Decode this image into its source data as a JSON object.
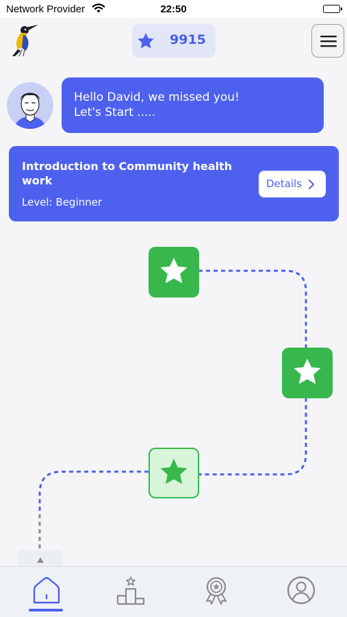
{
  "status_bar": {
    "carrier": "Network Provider",
    "time": "22:50"
  },
  "header": {
    "points": "9915",
    "icons": {
      "logo": "bird-logo",
      "points": "star-icon",
      "menu": "hamburger-menu-icon"
    }
  },
  "greeting": {
    "line1": "Hello David, we missed you!",
    "line2": "Let's Start ....."
  },
  "course": {
    "title": "Introduction to Community health work",
    "level": "Level: Beginner",
    "details_label": "Details"
  },
  "levels": [
    {
      "status": "completed"
    },
    {
      "status": "completed"
    },
    {
      "status": "current"
    }
  ],
  "tabs": [
    {
      "name": "home",
      "icon": "home-icon",
      "active": true
    },
    {
      "name": "leaderboard",
      "icon": "podium-icon",
      "active": false
    },
    {
      "name": "achievements",
      "icon": "badge-icon",
      "active": false
    },
    {
      "name": "profile",
      "icon": "user-icon",
      "active": false
    }
  ],
  "colors": {
    "accent": "#4d61ee",
    "success": "#38b84c",
    "success_light": "#d8f5da",
    "pill_bg": "#e3e6f7",
    "background": "#f5f5f7"
  }
}
